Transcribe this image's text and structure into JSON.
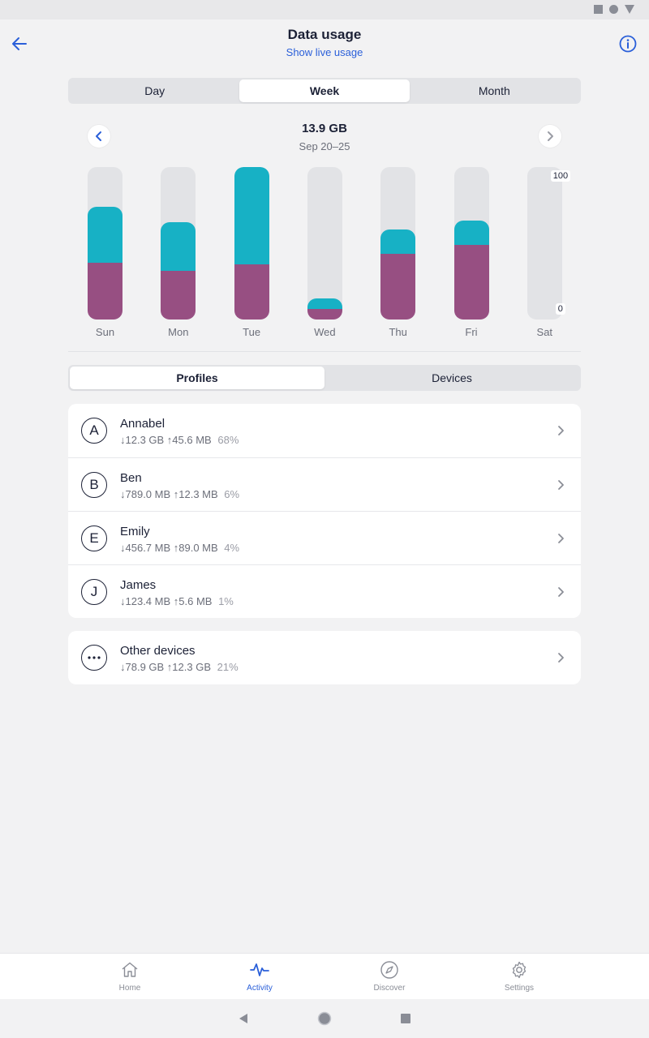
{
  "header": {
    "title": "Data usage",
    "live_link": "Show live usage"
  },
  "period_tabs": [
    "Day",
    "Week",
    "Month"
  ],
  "active_period": "Week",
  "week": {
    "total": "13.9 GB",
    "range": "Sep 20–25"
  },
  "chart_data": {
    "type": "bar",
    "stacked": true,
    "categories": [
      "Sun",
      "Mon",
      "Tue",
      "Wed",
      "Thu",
      "Fri",
      "Sat"
    ],
    "series": [
      {
        "values": [
          37,
          32,
          36,
          7,
          43,
          49,
          0
        ],
        "color": "#974f82"
      },
      {
        "values": [
          37,
          32,
          64,
          7,
          16,
          16,
          0
        ],
        "color": "#17b1c5"
      }
    ],
    "ylim": [
      0,
      100
    ],
    "tick_labels": [
      "100",
      "0"
    ]
  },
  "list_tabs": [
    "Profiles",
    "Devices"
  ],
  "active_list_tab": "Profiles",
  "profiles": [
    {
      "initial": "A",
      "name": "Annabel",
      "stats": "↓12.3 GB ↑45.6 MB",
      "pct": "68%"
    },
    {
      "initial": "B",
      "name": "Ben",
      "stats": "↓789.0 MB ↑12.3 MB",
      "pct": "6%"
    },
    {
      "initial": "E",
      "name": "Emily",
      "stats": "↓456.7 MB ↑89.0 MB",
      "pct": "4%"
    },
    {
      "initial": "J",
      "name": "James",
      "stats": "↓123.4 MB ↑5.6 MB",
      "pct": "1%"
    }
  ],
  "other_devices": {
    "name": "Other devices",
    "stats": "↓78.9 GB ↑12.3 GB",
    "pct": "21%"
  },
  "tabbar": [
    {
      "label": "Home",
      "icon": "home-icon"
    },
    {
      "label": "Activity",
      "icon": "activity-icon"
    },
    {
      "label": "Discover",
      "icon": "compass-icon"
    },
    {
      "label": "Settings",
      "icon": "gear-icon"
    }
  ],
  "active_tab": "Activity",
  "colors": {
    "accent": "#2a5fd9",
    "upload": "#17b1c5",
    "download": "#974f82"
  }
}
